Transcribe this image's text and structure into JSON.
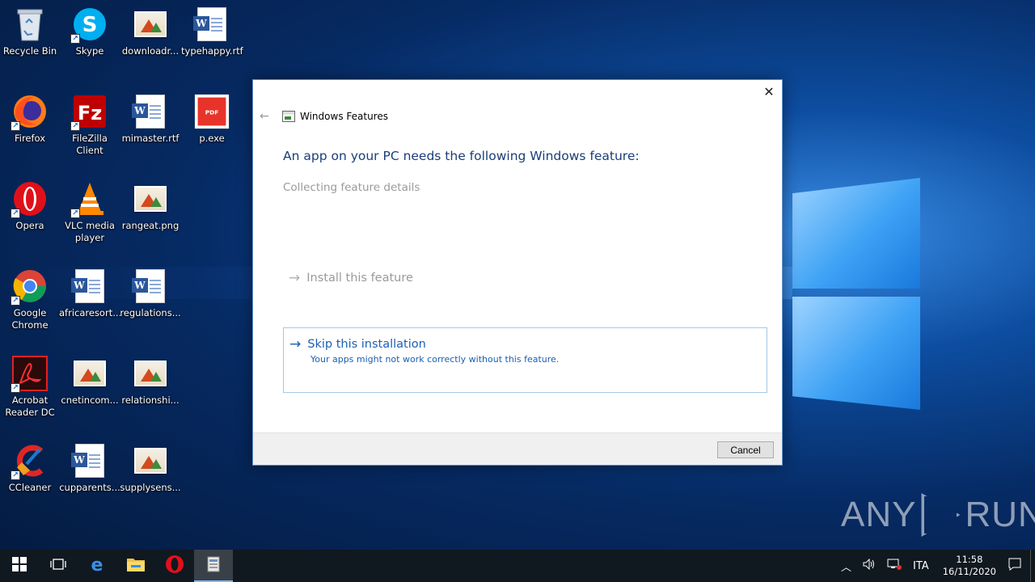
{
  "desktop": {
    "icons": [
      {
        "label": "Recycle Bin",
        "icon": "recycle-bin-icon"
      },
      {
        "label": "Skype",
        "icon": "skype-icon"
      },
      {
        "label": "downloadr...",
        "icon": "image-file-icon"
      },
      {
        "label": "typehappy.rtf",
        "icon": "word-document-icon"
      },
      {
        "label": "Firefox",
        "icon": "firefox-icon"
      },
      {
        "label": "FileZilla Client",
        "icon": "filezilla-icon"
      },
      {
        "label": "mimaster.rtf",
        "icon": "word-document-icon"
      },
      {
        "label": "p.exe",
        "icon": "pdf-exe-icon"
      },
      {
        "label": "Opera",
        "icon": "opera-icon"
      },
      {
        "label": "VLC media player",
        "icon": "vlc-icon"
      },
      {
        "label": "rangeat.png",
        "icon": "image-file-icon"
      },
      {
        "label": "Google Chrome",
        "icon": "chrome-icon"
      },
      {
        "label": "africaresort...",
        "icon": "word-document-icon"
      },
      {
        "label": "regulations...",
        "icon": "word-document-icon"
      },
      {
        "label": "Acrobat Reader DC",
        "icon": "acrobat-icon"
      },
      {
        "label": "cnetincom...",
        "icon": "image-file-icon"
      },
      {
        "label": "relationshi...",
        "icon": "image-file-icon"
      },
      {
        "label": "CCleaner",
        "icon": "ccleaner-icon"
      },
      {
        "label": "cupparents...",
        "icon": "word-document-icon"
      },
      {
        "label": "supplysens...",
        "icon": "image-file-icon"
      }
    ]
  },
  "dialog": {
    "title": "Windows Features",
    "headline": "An app on your PC needs the following Windows feature:",
    "status": "Collecting feature details",
    "install_option": "Install this feature",
    "skip_option": "Skip this installation",
    "skip_subtext": "Your apps might not work correctly without this feature.",
    "cancel_label": "Cancel",
    "close_glyph": "✕"
  },
  "watermark": {
    "left": "ANY",
    "right": "RUN"
  },
  "taskbar": {
    "apps": [
      {
        "name": "start-button",
        "icon": "windows-logo-icon"
      },
      {
        "name": "task-view-button",
        "icon": "task-view-icon"
      },
      {
        "name": "edge-button",
        "icon": "edge-icon"
      },
      {
        "name": "file-explorer-button",
        "icon": "folder-icon"
      },
      {
        "name": "opera-taskbar-button",
        "icon": "opera-icon"
      },
      {
        "name": "windows-features-taskbar-button",
        "icon": "windows-features-icon",
        "active": true
      }
    ],
    "tray": {
      "language": "ITA",
      "time": "11:58",
      "date": "16/11/2020"
    }
  },
  "colors": {
    "dialog_accent": "#1a5fb4",
    "headline": "#1a3e78",
    "taskbar": "#101820"
  }
}
